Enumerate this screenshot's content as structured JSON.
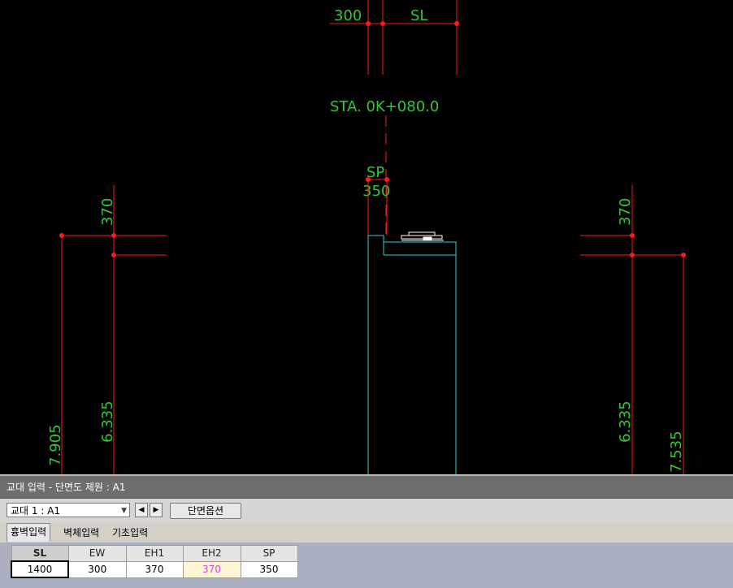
{
  "drawing": {
    "top_labels": {
      "left_dim": "300",
      "right_dim": "SL"
    },
    "station": "STA. 0K+080.0",
    "sp_label": "SP",
    "sp_value": "350",
    "left_dims": {
      "top": "370",
      "mid": "6.335",
      "outer": "7.905"
    },
    "right_dims": {
      "top": "370",
      "mid": "6.335",
      "outer": "7.535"
    },
    "colors": {
      "dimension_line": "#ff1a1a",
      "text": "#2fc92f",
      "structure": "#23d3d3",
      "point": "#ff1a1a"
    }
  },
  "panel": {
    "title": "교대 입력 - 단면도 제원 : A1",
    "selector_value": "교대 1 : A1",
    "prev_icon": "◀",
    "next_icon": "▶",
    "options_button": "단면옵션",
    "tabs": [
      {
        "label": "흉벽입력",
        "active": true
      },
      {
        "label": "벽체입력",
        "active": false
      },
      {
        "label": "기초입력",
        "active": false
      }
    ],
    "grid": {
      "headers": [
        "SL",
        "EW",
        "EH1",
        "EH2",
        "SP"
      ],
      "values": [
        "1400",
        "300",
        "370",
        "370",
        "350"
      ]
    }
  }
}
